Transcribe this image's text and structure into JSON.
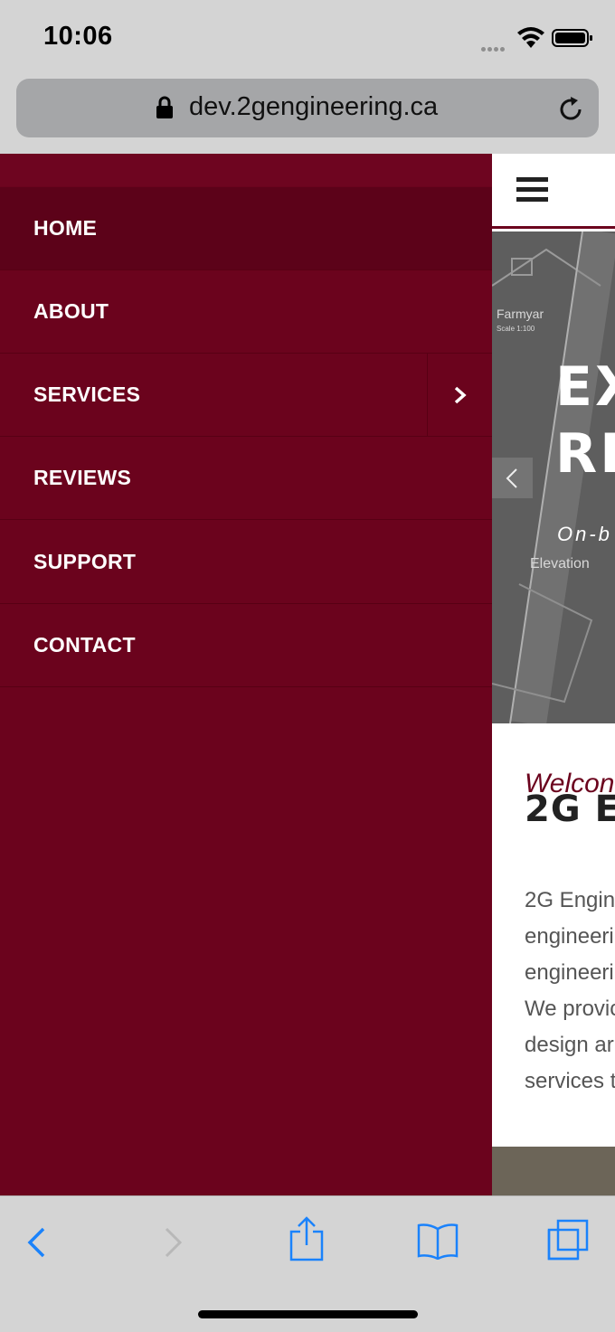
{
  "status_bar": {
    "time": "10:06"
  },
  "browser": {
    "url": "dev.2gengineering.ca"
  },
  "menu": {
    "items": [
      {
        "label": "HOME",
        "active": true
      },
      {
        "label": "ABOUT"
      },
      {
        "label": "SERVICES",
        "has_submenu": true
      },
      {
        "label": "REVIEWS"
      },
      {
        "label": "SUPPORT"
      },
      {
        "label": "CONTACT"
      }
    ]
  },
  "hero": {
    "title_line1": "EX",
    "title_line2": "RE",
    "subtitle": "On-b",
    "sketch_labels": [
      "Farmyar",
      "Scale 1:100",
      "Elevation"
    ]
  },
  "welcome": {
    "kicker": "Welcon",
    "heading": "2G E",
    "body_lines": [
      "2G Engine",
      "engineeri",
      "engineeri",
      "We provic",
      "design ar",
      "services t"
    ]
  },
  "colors": {
    "brand": "#6b031d",
    "ios_blue": "#1a82fb"
  },
  "toolbar": {
    "icons": [
      "back-icon",
      "forward-icon",
      "share-icon",
      "bookmarks-icon",
      "tabs-icon"
    ]
  }
}
